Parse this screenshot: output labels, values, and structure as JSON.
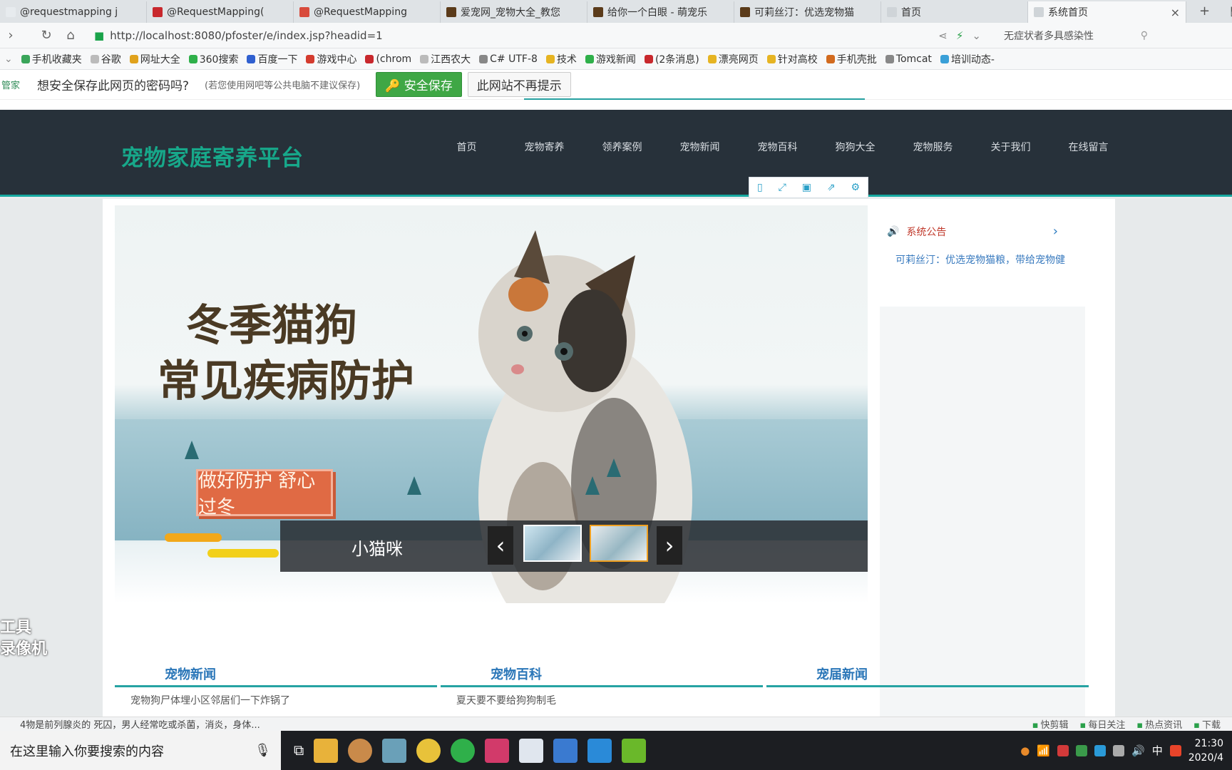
{
  "browser": {
    "tabs": [
      {
        "label": "@requestmapping j",
        "color": "#e7ebee",
        "active": false
      },
      {
        "label": "@RequestMapping(",
        "color": "#c8282d",
        "active": false
      },
      {
        "label": "@RequestMapping",
        "color": "#d84b3c",
        "active": false
      },
      {
        "label": "爱宠网_宠物大全_教您",
        "color": "#5b3b1a",
        "active": false
      },
      {
        "label": "给你一个白眼 - 萌宠乐",
        "color": "#5b3b1a",
        "active": false
      },
      {
        "label": "可莉丝汀：优选宠物猫",
        "color": "#5b3b1a",
        "active": false
      },
      {
        "label": "首页",
        "color": "#cfd4d8",
        "active": false
      },
      {
        "label": "系统首页",
        "color": "#cfd4d8",
        "active": true
      }
    ],
    "tab_close": "×",
    "new_tab": "+",
    "url": "http://localhost:8080/pfoster/e/index.jsp?headid=1",
    "search_placeholder": "无症状者多具感染性",
    "bookmarks": [
      {
        "label": "手机收藏夹",
        "color": "#3aa55a"
      },
      {
        "label": "谷歌",
        "color": "#bbbbbb"
      },
      {
        "label": "网址大全",
        "color": "#e0a21c"
      },
      {
        "label": "360搜索",
        "color": "#2fb04a"
      },
      {
        "label": "百度一下",
        "color": "#3060d0"
      },
      {
        "label": "游戏中心",
        "color": "#d43b2e"
      },
      {
        "label": "(chrom",
        "color": "#c8282d"
      },
      {
        "label": "江西农大",
        "color": "#bbbbbb"
      },
      {
        "label": "C# UTF-8",
        "color": "#888888"
      },
      {
        "label": "技术",
        "color": "#e6b422"
      },
      {
        "label": "游戏新闻",
        "color": "#2fb04a"
      },
      {
        "label": "(2条消息)",
        "color": "#c8282d"
      },
      {
        "label": "漂亮网页",
        "color": "#e6b422"
      },
      {
        "label": "针对高校",
        "color": "#e6b422"
      },
      {
        "label": "手机壳批",
        "color": "#d26a1e"
      },
      {
        "label": "Tomcat",
        "color": "#888888"
      },
      {
        "label": "培训动态-",
        "color": "#3aa0d8"
      }
    ],
    "password_bar": {
      "brand": "管家",
      "question": "想安全保存此网页的密码吗?",
      "note": "(若您使用网吧等公共电脑不建议保存)",
      "save_label": "安全保存",
      "never_label": "此网站不再提示"
    }
  },
  "site": {
    "logo": "宠物家庭寄养平台",
    "nav": [
      "首页",
      "宠物寄养",
      "领养案例",
      "宠物新闻",
      "宠物百科",
      "狗狗大全",
      "宠物服务",
      "关于我们",
      "在线留言"
    ],
    "banner": {
      "headline_line1": "冬季猫狗",
      "headline_line2": "常见疾病防护",
      "stamp": "做好防护 舒心过冬",
      "caption": "小猫咪",
      "prev": "‹",
      "next": "›"
    },
    "notice": {
      "title": "系统公告",
      "item": "可莉丝汀：优选宠物猫粮，带给宠物健"
    },
    "sections": [
      {
        "title": "宠物新闻",
        "item": "宠物狗尸体埋小区邻居们一下炸锅了"
      },
      {
        "title": "宠物百科",
        "item": "夏天要不要给狗狗制毛"
      },
      {
        "title": "宠届新闻",
        "item": ""
      }
    ],
    "watermark_line1": "工具",
    "watermark_line2": "录像机"
  },
  "statusbar": {
    "news": "4物是前列腺炎的 死囚，男人经常吃或杀菌，消炎，身体...",
    "items": [
      "快剪辑",
      "每日关注",
      "热点资讯",
      "下载"
    ]
  },
  "taskbar": {
    "search_placeholder": "在这里输入你要搜索的内容",
    "ime": "中",
    "time": "21:30",
    "date": "2020/4"
  }
}
